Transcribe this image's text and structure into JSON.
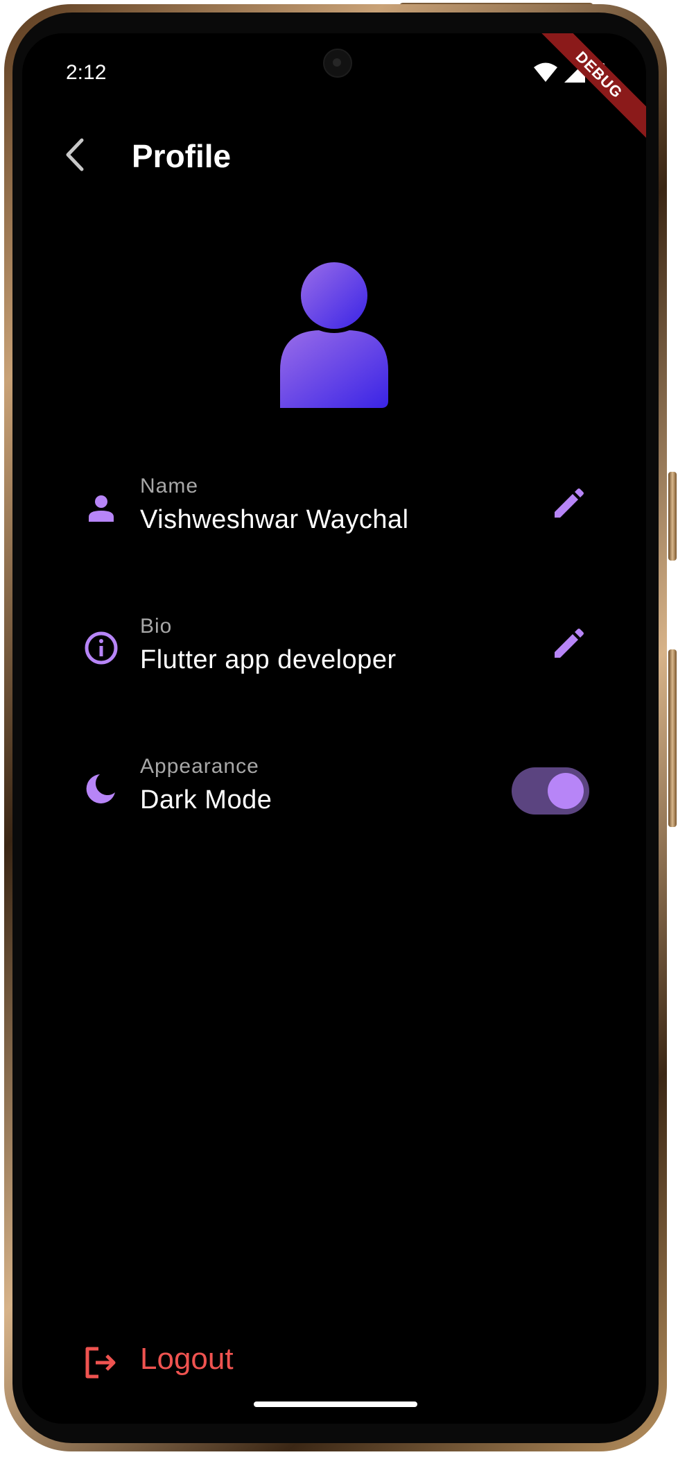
{
  "status_bar": {
    "time": "2:12",
    "debug_banner": "DEBUG",
    "icons": [
      "wifi-icon",
      "signal-icon",
      "battery-icon"
    ]
  },
  "app_bar": {
    "title": "Profile",
    "back_icon": "chevron-left-icon"
  },
  "avatar": {
    "icon": "person-icon",
    "gradient": [
      "#9a6de8",
      "#3a24e6"
    ]
  },
  "rows": [
    {
      "label": "Name",
      "value": "Vishweshwar Waychal",
      "icon": "person-icon",
      "action": "edit-icon"
    },
    {
      "label": "Bio",
      "value": "Flutter app developer",
      "icon": "info-icon",
      "action": "edit-icon"
    },
    {
      "label": "Appearance",
      "value": "Dark Mode",
      "icon": "moon-icon",
      "action": "toggle",
      "toggle_on": true
    }
  ],
  "logout": {
    "label": "Logout",
    "icon": "logout-icon"
  },
  "colors": {
    "accent": "#b785f7",
    "danger": "#ef5350",
    "background": "#000000",
    "label": "#a8a8a8",
    "toggle_track": "#5b4480"
  }
}
